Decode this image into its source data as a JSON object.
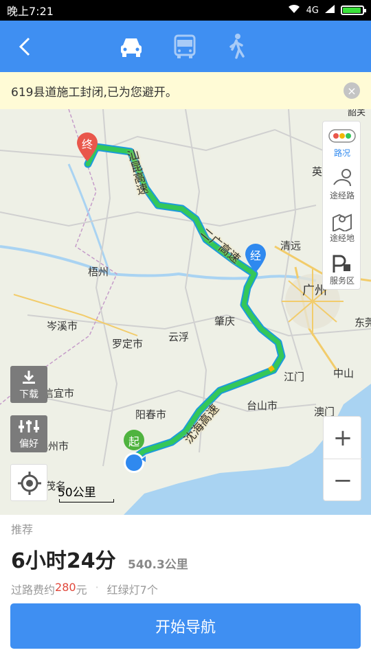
{
  "status": {
    "time": "晚上7:21",
    "net": "4G",
    "battery_level": 0.92
  },
  "nav": {
    "back_icon": "back-arrow-icon",
    "modes": [
      "car-icon",
      "bus-icon",
      "walk-icon"
    ],
    "active_mode": "car"
  },
  "banner": {
    "text": "619县道施工封闭,已为您避开。"
  },
  "map": {
    "cities": [
      "梧州",
      "清远",
      "广州",
      "肇庆",
      "东莞",
      "岑溪市",
      "罗定市",
      "云浮",
      "中山",
      "江门",
      "信宜市",
      "阳春市",
      "台山市",
      "澳门",
      "化州市",
      "茂名",
      "英",
      "韶关"
    ],
    "route_labels": [
      "汕昆高速",
      "二广高速",
      "沈海高速"
    ],
    "markers": {
      "end": "终",
      "via": "经",
      "start": "起"
    },
    "scale": "50公里"
  },
  "tools": {
    "traffic": "路况",
    "waypoint": "途经路",
    "via_place": "途经地",
    "service": "服务区",
    "download": "下载",
    "preference": "偏好",
    "zoom_in": "+",
    "zoom_out": "−"
  },
  "route": {
    "tag": "推荐",
    "duration": "6小时24分",
    "distance": "540.3公里",
    "toll_prefix": "过路费约",
    "toll_value": "280",
    "toll_suffix": "元",
    "separator": "·",
    "lights": "红绿灯7个"
  },
  "start_button": "开始导航",
  "colors": {
    "accent": "#3f8ff2",
    "route": "#34c759",
    "end_marker": "#e9574b",
    "via_marker": "#2f89ef",
    "start_marker": "#4fb33f"
  }
}
